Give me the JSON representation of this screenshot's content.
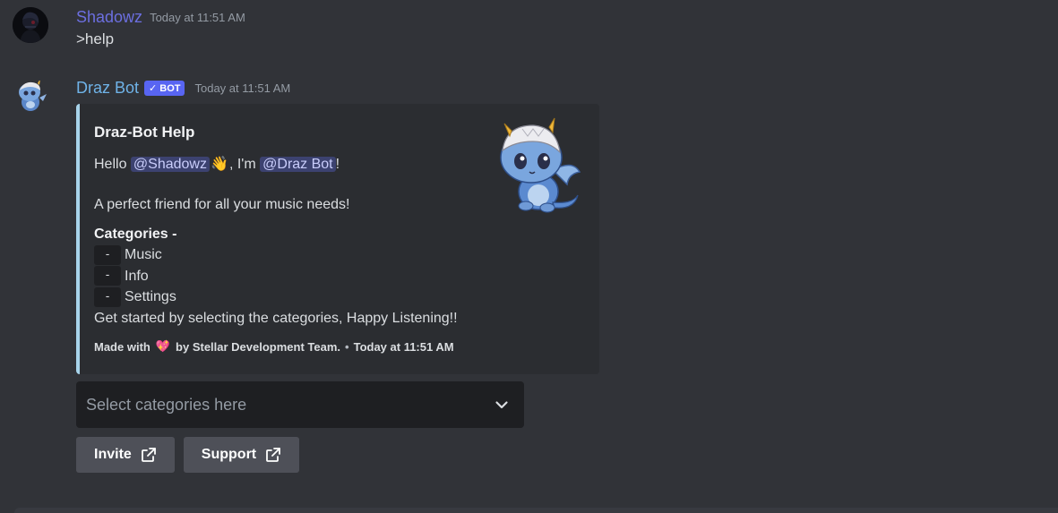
{
  "messages": [
    {
      "author": "Shadowz",
      "timestamp": "Today at 11:51 AM",
      "content": ">help"
    },
    {
      "author": "Draz Bot",
      "bot_tag": "BOT",
      "bot_check": "✓",
      "timestamp": "Today at 11:51 AM",
      "embed": {
        "title": "Draz-Bot Help",
        "hello_prefix": "Hello ",
        "mention_user": "@Shadowz",
        "wave_emoji": "👋",
        "im_text": ", I'm ",
        "mention_bot": "@Draz Bot",
        "bang": "!",
        "tagline": "A perfect friend for all your music needs!",
        "categories_title": "Categories -",
        "dash": "-",
        "categories": [
          "Music",
          "Info",
          "Settings"
        ],
        "closing": "Get started by selecting the categories, Happy Listening!!",
        "footer_prefix": "Made with",
        "footer_heart": "💖",
        "footer_suffix": "by Stellar Development Team.",
        "footer_sep": "•",
        "footer_time": "Today at 11:51 AM",
        "accent_color": "#a7d3ea"
      },
      "select_placeholder": "Select categories here",
      "buttons": [
        {
          "label": "Invite",
          "icon": "external-link-icon"
        },
        {
          "label": "Support",
          "icon": "external-link-icon"
        }
      ]
    }
  ],
  "colors": {
    "background": "#313338",
    "embed_bg": "#2b2d31",
    "bot_tag": "#5865f2",
    "button": "#4e5058"
  }
}
